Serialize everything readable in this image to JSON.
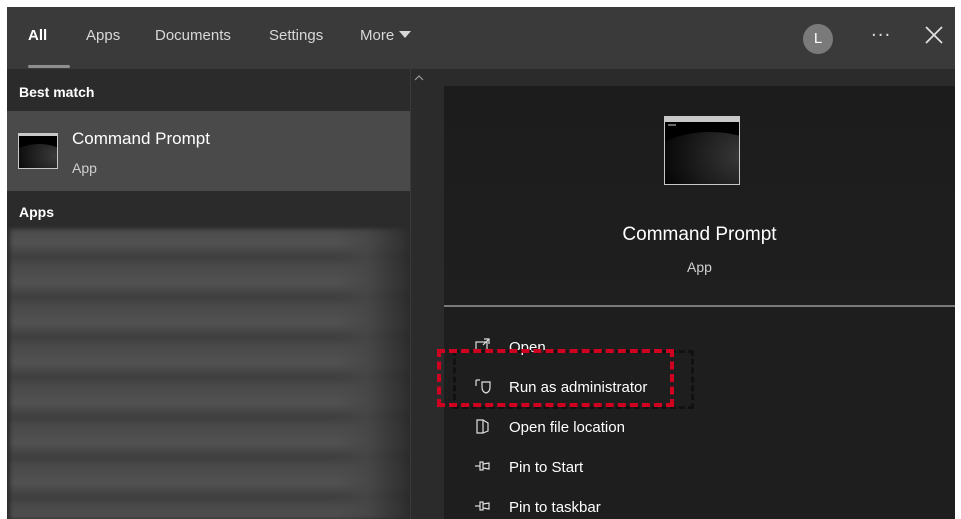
{
  "tabs": [
    {
      "label": "All",
      "active": true
    },
    {
      "label": "Apps"
    },
    {
      "label": "Documents"
    },
    {
      "label": "Settings"
    },
    {
      "label": "More"
    }
  ],
  "topbar": {
    "avatar_letter": "L",
    "more_options": "···"
  },
  "left": {
    "best_match_label": "Best match",
    "best_match": {
      "title": "Command Prompt",
      "subtitle": "App"
    },
    "apps_label": "Apps"
  },
  "detail": {
    "title": "Command Prompt",
    "subtitle": "App"
  },
  "actions": [
    {
      "label": "Open",
      "icon": "open-icon"
    },
    {
      "label": "Run as administrator",
      "icon": "shield-icon"
    },
    {
      "label": "Open file location",
      "icon": "folder-icon"
    },
    {
      "label": "Pin to Start",
      "icon": "pin-icon"
    },
    {
      "label": "Pin to taskbar",
      "icon": "pin-icon"
    }
  ],
  "colors": {
    "annotation": "#d00020",
    "panel": "#2b2b2b",
    "selected_row": "#4a4a4a"
  }
}
